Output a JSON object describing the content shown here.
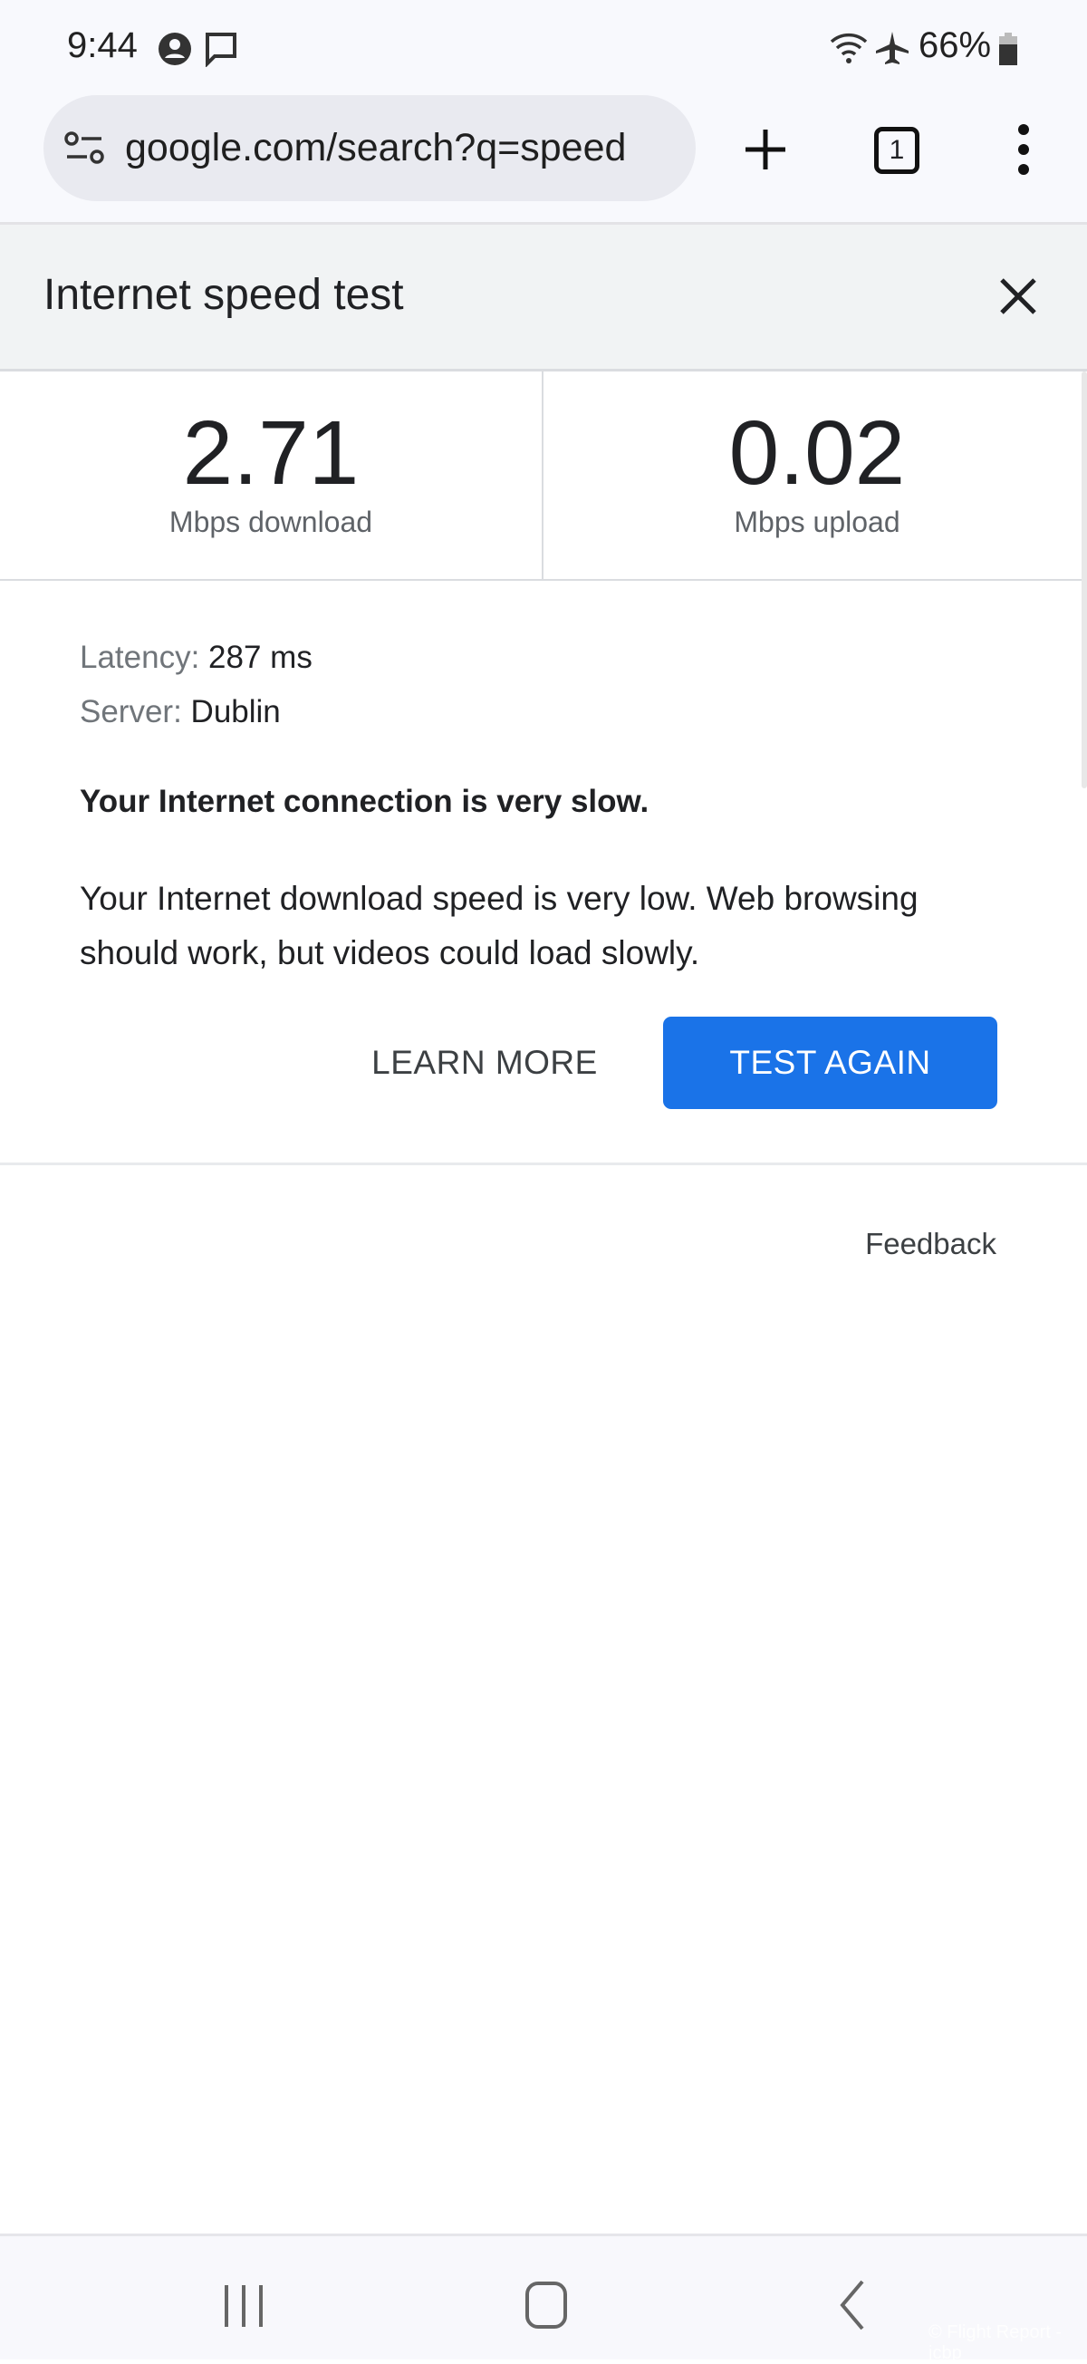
{
  "status_bar": {
    "time": "9:44",
    "battery": "66%",
    "icons": [
      "account-circle-icon",
      "message-icon",
      "wifi-icon",
      "airplane-icon",
      "battery-icon"
    ]
  },
  "browser": {
    "url": "google.com/search?q=speed",
    "tab_count": "1"
  },
  "panel": {
    "title": "Internet speed test",
    "download": {
      "value": "2.71",
      "unit": "Mbps download"
    },
    "upload": {
      "value": "0.02",
      "unit": "Mbps upload"
    },
    "latency_label": "Latency:",
    "latency_value": "287 ms",
    "server_label": "Server:",
    "server_value": "Dublin",
    "verdict": "Your Internet connection is very slow.",
    "description": "Your Internet download speed is very low. Web browsing should work, but videos could load slowly.",
    "learn_more": "LEARN MORE",
    "test_again": "TEST AGAIN",
    "feedback": "Feedback"
  },
  "watermark": "© Flight Report - jcbp",
  "colors": {
    "accent": "#1a73e8",
    "header_bg": "#f1f3f4"
  }
}
